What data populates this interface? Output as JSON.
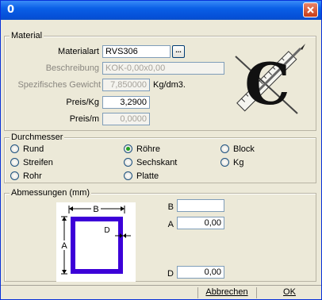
{
  "window": {
    "title": "0",
    "close_label": "X"
  },
  "material": {
    "legend": "Material",
    "materialart_label": "Materialart",
    "materialart_value": "RVS306",
    "ellipsis_label": "...",
    "beschreibung_label": "Beschreibung",
    "beschreibung_value": "KOK-0,00x0,00",
    "gewicht_label": "Spezifisches Gewicht",
    "gewicht_value": "7,850000",
    "gewicht_unit": "Kg/dm3.",
    "preis_kg_label": "Preis/Kg",
    "preis_kg_value": "3,2900",
    "preis_m_label": "Preis/m",
    "preis_m_value": "0,0000",
    "logo_letter": "C"
  },
  "durchmesser": {
    "legend": "Durchmesser",
    "options": [
      {
        "label": "Rund",
        "checked": false
      },
      {
        "label": "Röhre",
        "checked": true
      },
      {
        "label": "Block",
        "checked": false
      },
      {
        "label": "Streifen",
        "checked": false
      },
      {
        "label": "Sechskant",
        "checked": false
      },
      {
        "label": "Kg",
        "checked": false
      },
      {
        "label": "Rohr",
        "checked": false
      },
      {
        "label": "Platte",
        "checked": false
      }
    ]
  },
  "abmessungen": {
    "legend": "Abmessungen (mm)",
    "diagram_label_b": "B",
    "diagram_label_a": "A",
    "diagram_label_d": "D",
    "b_label": "B",
    "b_value": "",
    "a_label": "A",
    "a_value": "0,00",
    "d_label": "D",
    "d_value": "0,00"
  },
  "status": {
    "abbrechen_label": "Abbrechen",
    "ok_label": "OK"
  },
  "colors": {
    "diagram_frame": "#3c00d8",
    "radio_dot": "#21a121"
  }
}
